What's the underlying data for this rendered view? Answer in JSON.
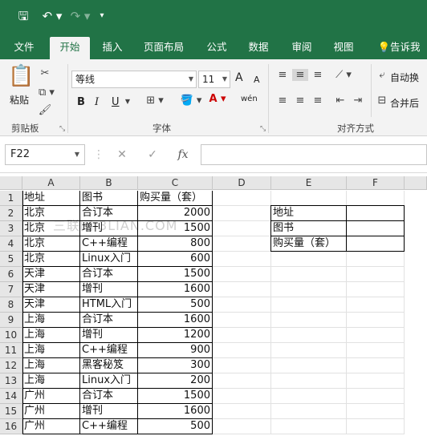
{
  "quick_access": {
    "save": "🖫",
    "undo": "↶ ▾",
    "redo": "↷ ▾",
    "more": "▾"
  },
  "tabs": [
    "文件",
    "开始",
    "插入",
    "页面布局",
    "公式",
    "数据",
    "审阅",
    "视图",
    "告诉我"
  ],
  "active_tab": "开始",
  "ribbon": {
    "clipboard": {
      "paste": "粘贴",
      "group": "剪贴板"
    },
    "font": {
      "name": "等线",
      "size": "11",
      "grow": "A",
      "shrink": "A",
      "bold": "B",
      "italic": "I",
      "underline": "U",
      "phonetic": "wén",
      "group": "字体"
    },
    "alignment": {
      "wrap": "自动换",
      "merge": "合并后",
      "group": "对齐方式"
    }
  },
  "formula_bar": {
    "name_box": "F22",
    "fx": "fx",
    "value": ""
  },
  "columns": [
    "A",
    "B",
    "C",
    "D",
    "E",
    "F"
  ],
  "rows": [
    [
      "地址",
      "图书",
      "购买量（套）"
    ],
    [
      "北京",
      "合订本",
      "2000"
    ],
    [
      "北京",
      "增刊",
      "1500"
    ],
    [
      "北京",
      "C++编程",
      "800"
    ],
    [
      "北京",
      "Linux入门",
      "600"
    ],
    [
      "天津",
      "合订本",
      "1500"
    ],
    [
      "天津",
      "增刊",
      "1600"
    ],
    [
      "天津",
      "HTML入门",
      "500"
    ],
    [
      "上海",
      "合订本",
      "1600"
    ],
    [
      "上海",
      "增刊",
      "1200"
    ],
    [
      "上海",
      "C++编程",
      "900"
    ],
    [
      "上海",
      "黑客秘笈",
      "300"
    ],
    [
      "上海",
      "Linux入门",
      "200"
    ],
    [
      "广州",
      "合订本",
      "1500"
    ],
    [
      "广州",
      "增刊",
      "1600"
    ],
    [
      "广州",
      "C++编程",
      "500"
    ]
  ],
  "criteria_labels": [
    "地址",
    "图书",
    "购买量（套）"
  ],
  "watermark": "三联网 3LIAN.COM"
}
